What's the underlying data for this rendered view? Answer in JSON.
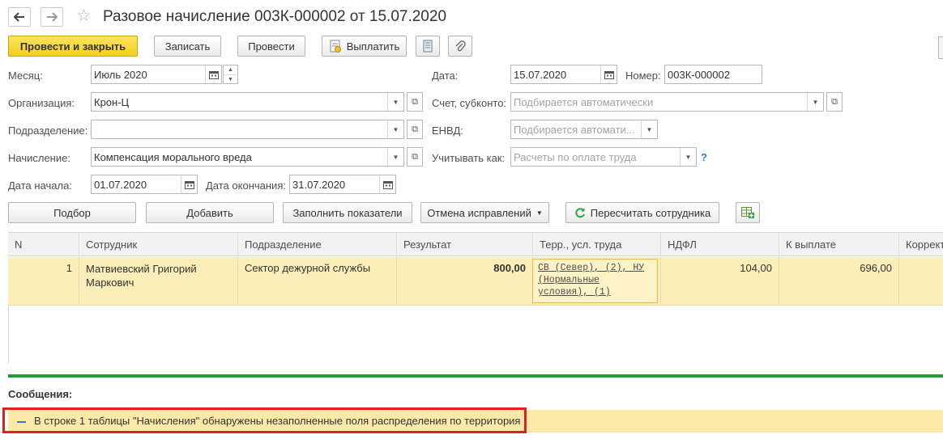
{
  "window": {
    "title": "Разовое начисление 003К-000002 от 15.07.2020",
    "back_icon": "arrow-left-icon",
    "forward_icon": "arrow-right-icon",
    "favorite_icon": "star-icon"
  },
  "toolbar": {
    "post_close": "Провести и закрыть",
    "save": "Записать",
    "post": "Провести",
    "pay": "Выплатить"
  },
  "form": {
    "month_label": "Месяц:",
    "month_value": "Июль 2020",
    "date_label": "Дата:",
    "date_value": "15.07.2020",
    "number_label": "Номер:",
    "number_value": "003К-000002",
    "org_label": "Организация:",
    "org_value": "Крон-Ц",
    "account_label": "Счет, субконто:",
    "account_placeholder": "Подбирается автоматически",
    "dept_label": "Подразделение:",
    "dept_value": "",
    "envd_label": "ЕНВД:",
    "envd_placeholder": "Подбирается автомати...",
    "accrual_label": "Начисление:",
    "accrual_value": "Компенсация морального вреда",
    "consider_label": "Учитывать как:",
    "consider_placeholder": "Расчеты по оплате труда",
    "help": "?",
    "start_label": "Дата начала:",
    "start_value": "01.07.2020",
    "end_label": "Дата окончания:",
    "end_value": "31.07.2020"
  },
  "actions": {
    "pick": "Подбор",
    "add": "Добавить",
    "fill": "Заполнить показатели",
    "cancel_fix": "Отмена исправлений",
    "recalc": "Пересчитать сотрудника"
  },
  "table": {
    "columns": [
      "N",
      "Сотрудник",
      "Подразделение",
      "Результат",
      "Терр., усл. труда",
      "НДФЛ",
      "К выплате",
      "Коррект"
    ],
    "rows": [
      {
        "n": "1",
        "employee": "Матвиевский Григорий Маркович",
        "dept": "Сектор дежурной службы",
        "result": "800,00",
        "territory": "СВ (Север), (2), НУ (Нормальные условия), (1)",
        "ndfl": "104,00",
        "payout": "696,00"
      }
    ]
  },
  "messages": {
    "title": "Сообщения:",
    "items": [
      "В строке 1 таблицы \"Начисления\" обнаружены незаполненные поля распределения по территория"
    ]
  },
  "colors": {
    "primary_button": "#f4cf22",
    "selected_row": "#fbeeb8",
    "message_bar": "#fbe9a8",
    "green_separator": "#1d9f3c",
    "highlight_outline": "#e3201b"
  }
}
